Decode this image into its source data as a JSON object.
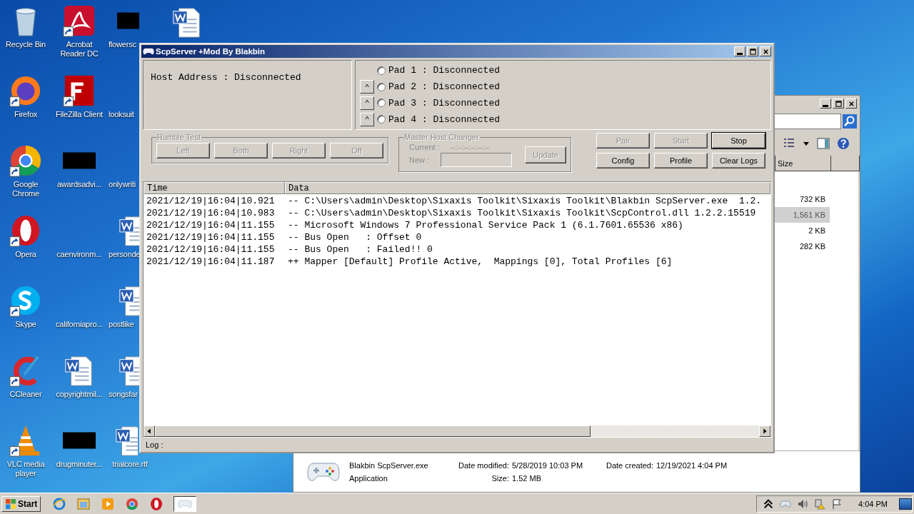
{
  "desktop_icons": [
    {
      "label": "Recycle Bin",
      "kind": "recycle",
      "shortcut": false
    },
    {
      "label": "Firefox",
      "kind": "firefox",
      "shortcut": true
    },
    {
      "label": "Google Chrome",
      "kind": "chrome",
      "shortcut": true
    },
    {
      "label": "Opera",
      "kind": "opera",
      "shortcut": true
    },
    {
      "label": "Skype",
      "kind": "skype",
      "shortcut": true
    },
    {
      "label": "CCleaner",
      "kind": "ccleaner",
      "shortcut": true
    },
    {
      "label": "VLC media player",
      "kind": "vlc",
      "shortcut": true
    },
    {
      "label": "Acrobat Reader DC",
      "kind": "acrobat",
      "shortcut": true
    },
    {
      "label": "FileZilla Client",
      "kind": "filezilla",
      "shortcut": true
    },
    {
      "label": "awardsadvi...",
      "kind": "redacted",
      "shortcut": false
    },
    {
      "label": "caenvironm...",
      "kind": "blank"
    },
    {
      "label": "californiapro...",
      "kind": "blank"
    },
    {
      "label": "copyrightmil...",
      "kind": "word",
      "shortcut": false
    },
    {
      "label": "drugminuter...",
      "kind": "redacted",
      "shortcut": false
    },
    {
      "label": "flowersc",
      "kind": "redacted",
      "shortcut": false
    },
    {
      "label": "looksuit",
      "kind": "blank"
    },
    {
      "label": "onlywriti",
      "kind": "blank"
    },
    {
      "label": "personde",
      "kind": "word",
      "shortcut": false
    },
    {
      "label": "postlike",
      "kind": "word",
      "shortcut": false
    },
    {
      "label": "songsfar",
      "kind": "word",
      "shortcut": false
    },
    {
      "label": "trialcore.rtf",
      "kind": "word",
      "shortcut": false
    }
  ],
  "desktop_extra_icons": [
    {
      "kind": "word"
    }
  ],
  "explorer": {
    "size_header": "Size",
    "rows": [
      {
        "size": "732 KB",
        "selected": false
      },
      {
        "size": "1,561 KB",
        "selected": true
      },
      {
        "size": "2 KB",
        "selected": false
      },
      {
        "size": "282 KB",
        "selected": false
      }
    ],
    "details": {
      "name": "Blakbin ScpServer.exe",
      "type": "Application",
      "modified_label": "Date modified:",
      "modified": "5/28/2019 10:03 PM",
      "created_label": "Date created:",
      "created": "12/19/2021 4:04 PM",
      "size_label": "Size:",
      "size": "1.52 MB"
    }
  },
  "scp_window": {
    "title": "ScpServer +Mod By Blakbin",
    "host_address": "Host Address : Disconnected",
    "pads": [
      {
        "label": "Pad 1 : Disconnected",
        "selected": false
      },
      {
        "label": "Pad 2 : Disconnected",
        "selected": false,
        "button": "^"
      },
      {
        "label": "Pad 3 : Disconnected",
        "selected": false,
        "button": "^"
      },
      {
        "label": "Pad 4 : Disconnected",
        "selected": false,
        "button": "^"
      }
    ],
    "rumble_test": {
      "title": "Rumble Test",
      "disabled": true,
      "buttons": [
        {
          "label": "Left",
          "disabled": true
        },
        {
          "label": "Both",
          "disabled": true
        },
        {
          "label": "Right",
          "disabled": true
        },
        {
          "label": "Off",
          "disabled": true
        }
      ]
    },
    "master_host_changer": {
      "title": "Master Host Changer",
      "disabled": true,
      "current_label": "Current :",
      "current_value": "--:--:--:--:--:--",
      "new_label": "New :",
      "update_button": {
        "label": "Update",
        "disabled": true
      }
    },
    "actions": [
      {
        "label": "Pair",
        "disabled": true,
        "default": false
      },
      {
        "label": "Start",
        "disabled": true,
        "default": false
      },
      {
        "label": "Stop",
        "disabled": false,
        "default": true
      },
      {
        "label": "Config",
        "disabled": false,
        "default": false
      },
      {
        "label": "Profile",
        "disabled": false,
        "default": false
      },
      {
        "label": "Clear Logs",
        "disabled": false,
        "default": false
      }
    ],
    "log": {
      "columns": [
        "Time",
        "Data"
      ],
      "rows": [
        [
          "2021/12/19|16:04|10.921",
          "-- C:\\Users\\admin\\Desktop\\Sixaxis Toolkit\\Sixaxis Toolkit\\Blakbin ScpServer.exe  1.2."
        ],
        [
          "2021/12/19|16:04|10.983",
          "-- C:\\Users\\admin\\Desktop\\Sixaxis Toolkit\\Sixaxis Toolkit\\ScpControl.dll 1.2.2.15519"
        ],
        [
          "2021/12/19|16:04|11.155",
          "-- Microsoft Windows 7 Professional Service Pack 1 (6.1.7601.65536 x86)"
        ],
        [
          "2021/12/19|16:04|11.155",
          "-- Bus Open   : Offset 0"
        ],
        [
          "2021/12/19|16:04|11.155",
          "-- Bus Open   : Failed!! 0"
        ],
        [
          "2021/12/19|16:04|11.187",
          "++ Mapper [Default] Profile Active,  Mappings [0], Total Profiles [6]"
        ]
      ]
    },
    "status": "Log :"
  },
  "taskbar": {
    "start": "Start",
    "pinned": [
      {
        "kind": "ie"
      },
      {
        "kind": "folder"
      },
      {
        "kind": "media"
      },
      {
        "kind": "chrome"
      },
      {
        "kind": "opera"
      }
    ],
    "tasks": [
      {
        "kind": "gamepad",
        "selected": true
      }
    ],
    "clock": "4:04 PM"
  }
}
